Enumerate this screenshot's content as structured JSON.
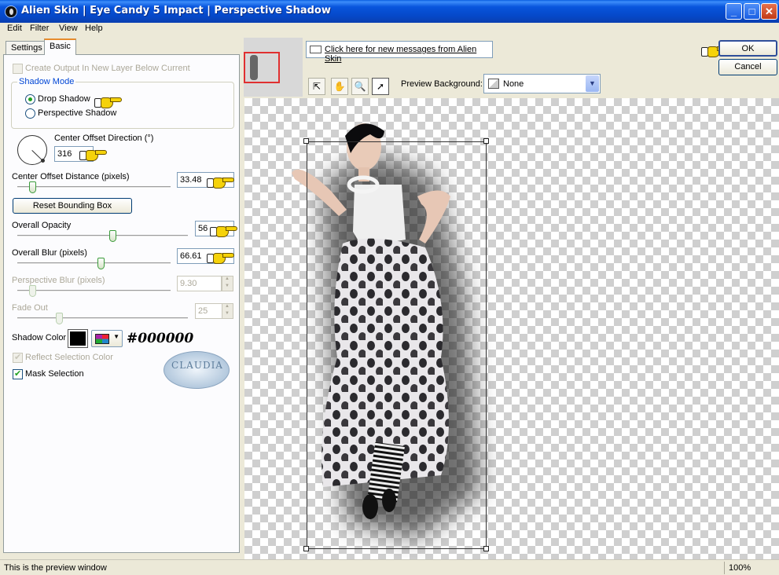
{
  "window": {
    "title": "Alien Skin  |  Eye Candy 5 Impact  |  Perspective Shadow",
    "min_label": "_",
    "max_label": "□",
    "close_label": "✕"
  },
  "menu": [
    "Edit",
    "Filter",
    "View",
    "Help"
  ],
  "tabs": {
    "settings": "Settings",
    "basic": "Basic",
    "active": "Basic"
  },
  "basic": {
    "create_output_label": "Create Output In New Layer Below Current",
    "create_output_checked": false,
    "create_output_enabled": false,
    "shadow_mode": {
      "title": "Shadow Mode",
      "options": [
        "Drop Shadow",
        "Perspective Shadow"
      ],
      "selected": "Drop Shadow"
    },
    "center_offset_direction": {
      "label": "Center Offset Direction (°)",
      "value": "316"
    },
    "center_offset_distance": {
      "label": "Center Offset Distance (pixels)",
      "value": "33.48",
      "slider": 0.1
    },
    "reset_bounding_box": "Reset Bounding Box",
    "overall_opacity": {
      "label": "Overall Opacity",
      "value": "56",
      "slider": 0.56
    },
    "overall_blur": {
      "label": "Overall Blur (pixels)",
      "value": "66.61",
      "slider": 0.55
    },
    "perspective_blur": {
      "label": "Perspective Blur (pixels)",
      "value": "9.30",
      "slider": 0.1,
      "enabled": false
    },
    "fade_out": {
      "label": "Fade Out",
      "value": "25",
      "slider": 0.25,
      "enabled": false
    },
    "shadow_color": {
      "label": "Shadow Color",
      "color": "#000000",
      "hex_note": "#000000"
    },
    "reflect_selection_color": {
      "label": "Reflect Selection Color",
      "checked": true,
      "enabled": false
    },
    "mask_selection": {
      "label": "Mask Selection",
      "checked": true
    }
  },
  "watermark": {
    "text": "CLAUDIA"
  },
  "message_link": "Click here for new messages from Alien Skin",
  "toolbar": {
    "tools": [
      "navigate-icon",
      "hand-icon",
      "zoom-icon",
      "arrow-icon"
    ],
    "preview_background_label": "Preview Background:",
    "preview_background_value": "None"
  },
  "buttons": {
    "ok": "OK",
    "cancel": "Cancel"
  },
  "status": {
    "message": "This is the preview window",
    "zoom": "100%"
  }
}
